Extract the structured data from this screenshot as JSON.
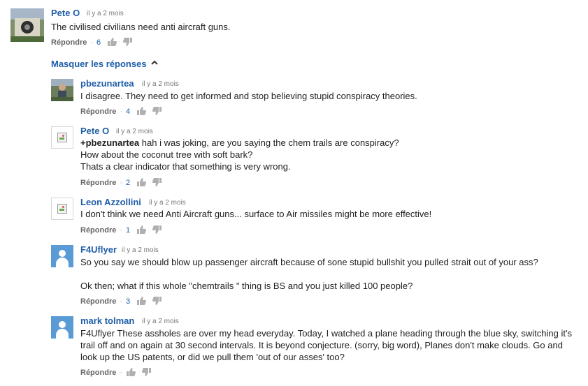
{
  "common": {
    "time_ago": "il y a 2 mois",
    "reply_label": "Répondre",
    "dot": "·"
  },
  "thread": {
    "toggle_label": "Masquer les réponses"
  },
  "top_comment": {
    "author": "Pete O",
    "time": "il y a 2 mois",
    "text": "The civilised civilians need anti aircraft guns.",
    "likes": "6"
  },
  "replies": [
    {
      "author": "pbezunartea",
      "time": "il y a 2 mois",
      "lines": [
        "I disagree. They need to get informed and stop believing stupid conspiracy theories."
      ],
      "likes": "4",
      "avatar": "photo"
    },
    {
      "author": "Pete O",
      "time": "il y a 2 mois",
      "mention": "+pbezunartea",
      "lines": [
        " hah i was joking, are you saying the chem trails are conspiracy?",
        "How about the coconut tree with soft bark?",
        "Thats a clear indicator that something is very wrong."
      ],
      "likes": "2",
      "avatar": "broken-image"
    },
    {
      "author": "Leon Azzollini",
      "time": "il y a 2 mois",
      "lines": [
        "I don't think we need Anti Aircraft guns...  surface to Air missiles might be more effective!"
      ],
      "likes": "1",
      "avatar": "broken-image"
    },
    {
      "author": "F4Uflyer",
      "time": "il y a 2 mois",
      "lines": [
        "So you say we should blow up passenger aircraft because of sone stupid bullshit you pulled strait out of your ass?",
        "",
        "Ok then; what if this whole \"chemtrails \" thing is BS and you just killed 100 people?"
      ],
      "likes": "3",
      "avatar": "default-user"
    },
    {
      "author": "mark tolman",
      "time": "il y a 2 mois",
      "text": "F4Uflyer These assholes are over my head everyday. Today, I watched a plane heading through the blue sky, switching it's trail off and on again at 30 second intervals. It is beyond conjecture. (sorry, big word), Planes don't make clouds. Go and look up the US patents, or did we pull them 'out of our asses' too?",
      "likes": "",
      "avatar": "default-user"
    }
  ],
  "colors": {
    "link_blue": "#1f5ea8",
    "muted": "#777777",
    "thumb_icon": "#b0b0b0"
  },
  "icons": [
    "thumbs-up-icon",
    "thumbs-down-icon",
    "chevron-up-icon",
    "broken-image-icon",
    "default-user-icon"
  ]
}
